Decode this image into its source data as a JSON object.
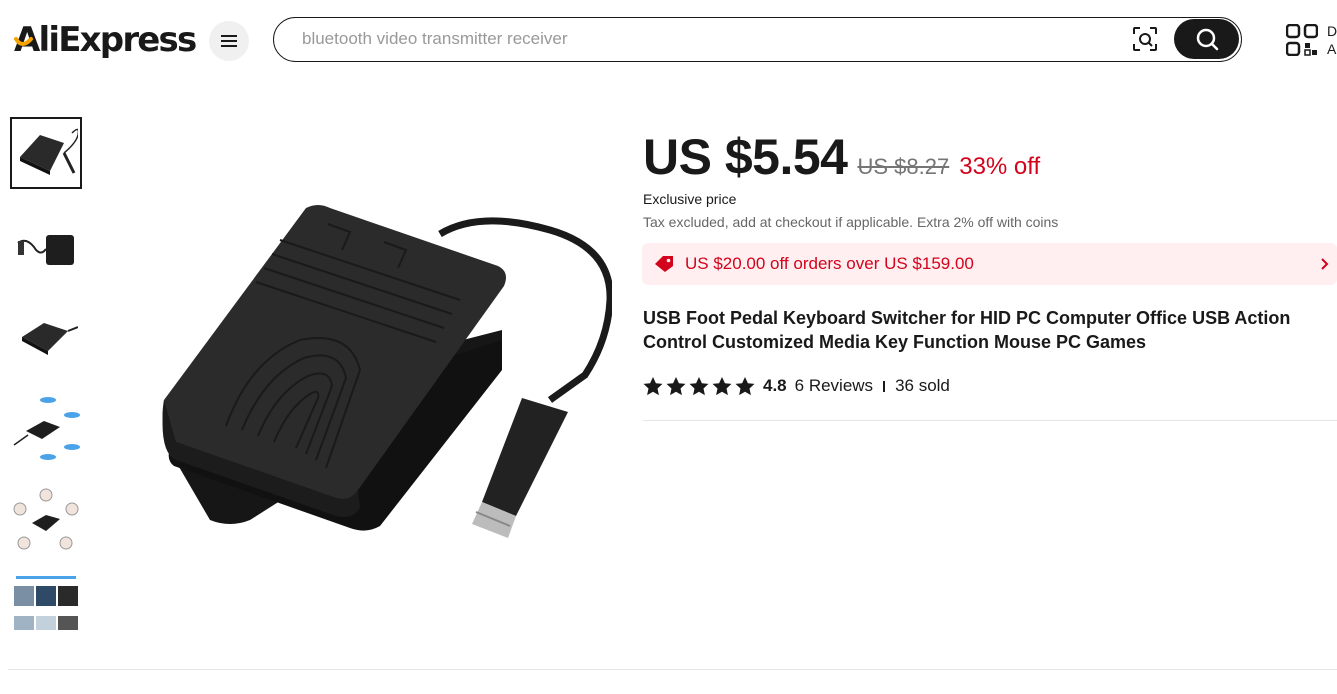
{
  "header": {
    "logo_text": "AliExpress",
    "search_placeholder": "bluetooth video transmitter receiver",
    "qr_label": "D A"
  },
  "product": {
    "price": "US $5.54",
    "original_price": "US $8.27",
    "discount": "33% off",
    "exclusive_label": "Exclusive price",
    "tax_note": "Tax excluded, add at checkout if applicable. Extra 2% off with coins",
    "coupon": "US $20.00 off orders over US $159.00",
    "title": "USB Foot Pedal Keyboard Switcher for HID PC Computer Office USB Action Control Customized Media Key Function Mouse PC Games",
    "rating": "4.8",
    "reviews": "6 Reviews",
    "sold": "36 sold"
  },
  "thumbnails": [
    "thumb-1",
    "thumb-2",
    "thumb-3",
    "thumb-4",
    "thumb-5",
    "thumb-6"
  ],
  "colors": {
    "accent_red": "#d3031c",
    "coupon_bg": "#ffeff0",
    "dark": "#191919",
    "logo_yellow": "#f7a300"
  }
}
